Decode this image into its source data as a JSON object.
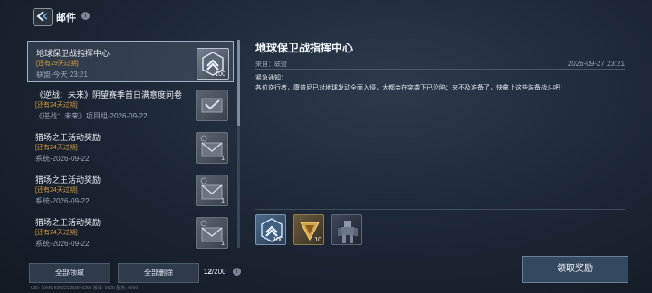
{
  "header": {
    "title": "邮件",
    "info_glyph": "i"
  },
  "mail_list": [
    {
      "title": "地球保卫战指挥中心",
      "expire": "[还有29天过期]",
      "meta": "联盟-今天 23:21",
      "icon": "gold-badge-icon",
      "count": "100",
      "selected": true
    },
    {
      "title": "《逆战：未来》阴望赛季首日满意度问卷",
      "expire": "[还有24天过期]",
      "meta": "《逆战：未来》项目组-2026-09-22",
      "icon": "envelope-check-icon",
      "count": "",
      "selected": false
    },
    {
      "title": "猎场之王活动奖励",
      "expire": "[还有24天过期]",
      "meta": "系统-2026-09-22",
      "icon": "envelope-icon",
      "count": "1",
      "selected": false
    },
    {
      "title": "猎场之王活动奖励",
      "expire": "[还有24天过期]",
      "meta": "系统-2026-09-22",
      "icon": "envelope-icon",
      "count": "1",
      "selected": false
    },
    {
      "title": "猎场之王活动奖励",
      "expire": "[还有24天过期]",
      "meta": "系统-2026-09-22",
      "icon": "envelope-icon",
      "count": "1",
      "selected": false
    }
  ],
  "bottom_bar": {
    "claim_all": "全部领取",
    "delete_all": "全部删除",
    "count_current": "12",
    "count_total": "/200",
    "footer_id": "UID: 79MS  505221233840296        版本: 0000   服务: 0000"
  },
  "detail": {
    "title": "地球保卫战指挥中心",
    "from": "来自：联盟",
    "date": "2026-09-27 23:21",
    "salutation": "紧急通知：",
    "body": "各位逆行者，康普尼已对地球发动全面入侵，大都会在突袭下已沦陷；来不及准备了，快拿上这些装备战斗吧！",
    "attachments": [
      {
        "icon": "blue-chevron-badge-icon",
        "count": "100"
      },
      {
        "icon": "gold-triangle-icon",
        "count": "10"
      },
      {
        "icon": "mech-robot-icon",
        "count": ""
      }
    ],
    "claim_button": "领取奖励"
  },
  "colors": {
    "expire": "#d59a3c",
    "accent": "#9fb0c4",
    "background": "#1b2533"
  }
}
